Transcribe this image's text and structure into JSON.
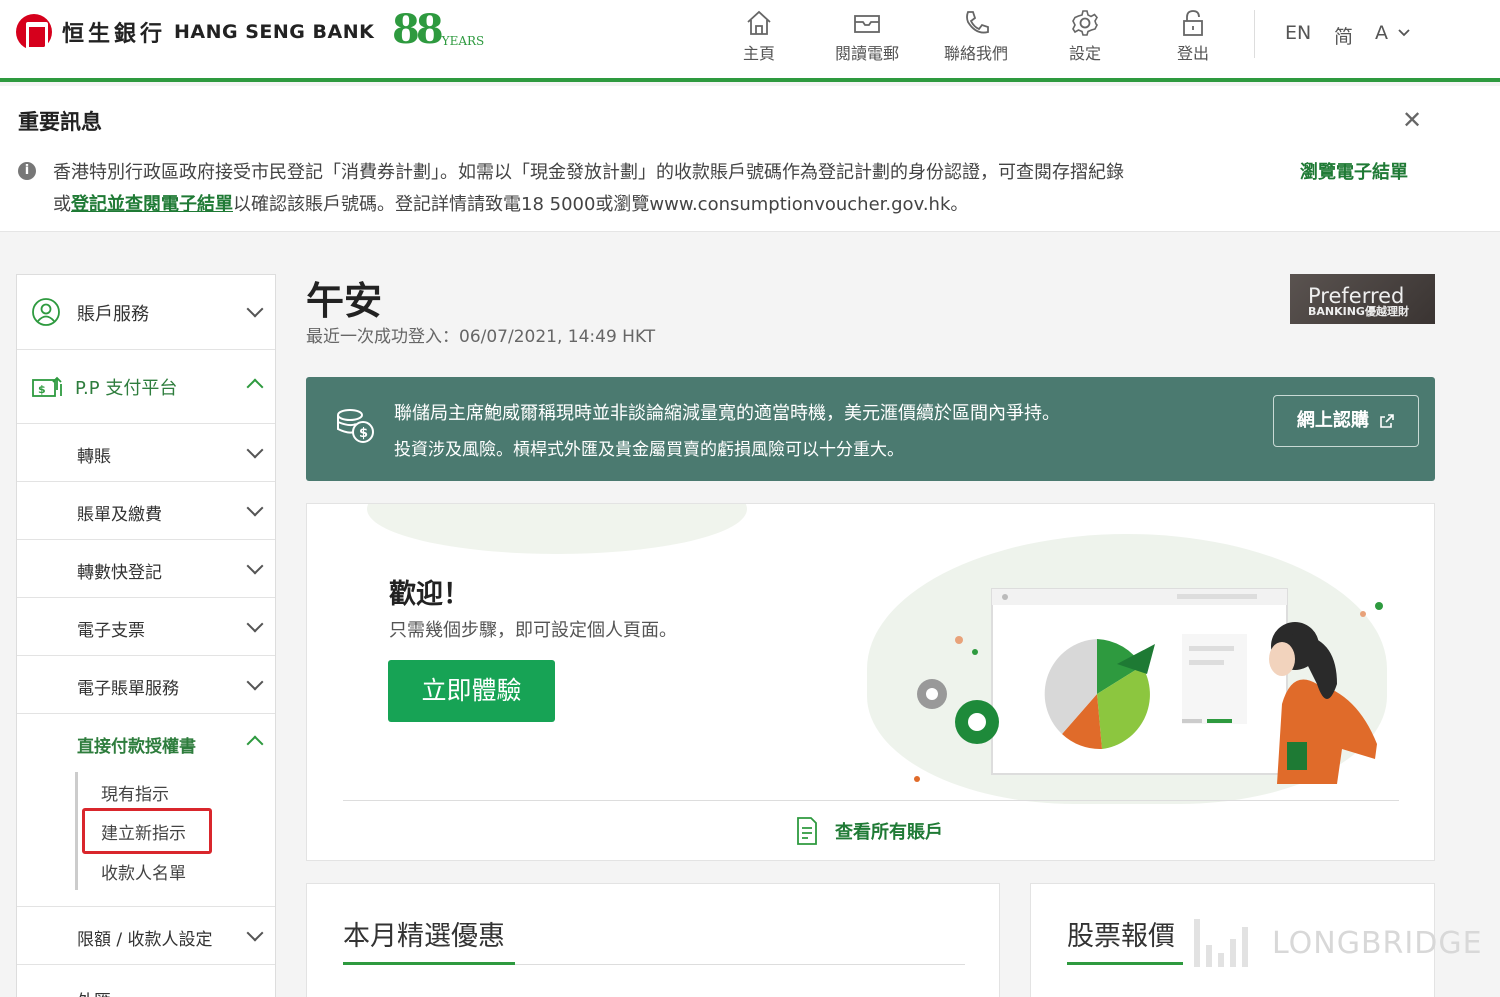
{
  "header": {
    "logo_cn": "恒生銀行",
    "logo_en": "HANG SENG BANK",
    "anniversary_number": "88",
    "anniversary_text": "YEARS",
    "nav": [
      {
        "label": "主頁",
        "icon": "home-icon"
      },
      {
        "label": "閱讀電郵",
        "icon": "mail-icon"
      },
      {
        "label": "聯絡我們",
        "icon": "phone-icon"
      },
      {
        "label": "設定",
        "icon": "gear-icon"
      },
      {
        "label": "登出",
        "icon": "lock-icon"
      }
    ],
    "lang_en": "EN",
    "lang_sc": "简",
    "font_size": "A"
  },
  "notice": {
    "title": "重要訊息",
    "line1": "香港特別行政區政府接受市民登記「消費券計劃」。如需以「現金發放計劃」的收款賬戶號碼作為登記計劃的身份認證，可查閱存摺紀錄",
    "line2_prefix": "或",
    "line2_link": "登記並查閱電子結單",
    "line2_suffix": "以確認該賬戶號碼。登記詳情請致電18 5000或瀏覽www.consumptionvoucher.gov.hk。",
    "browse_link": "瀏覽電子結單"
  },
  "sidebar": {
    "account_services": "賬戶服務",
    "payment_platform": "P.P 支付平台",
    "items": [
      {
        "label": "轉賬"
      },
      {
        "label": "賬單及繳費"
      },
      {
        "label": "轉數快登記"
      },
      {
        "label": "電子支票"
      },
      {
        "label": "電子賬單服務"
      }
    ],
    "direct_debit": "直接付款授權書",
    "sub_items": [
      {
        "label": "現有指示"
      },
      {
        "label": "建立新指示"
      },
      {
        "label": "收款人名單"
      }
    ],
    "limit_settings": "限額 / 收款人設定",
    "next_item": "外匯"
  },
  "main": {
    "greeting": "午安",
    "last_login": "最近一次成功登入：06/07/2021, 14:49 HKT",
    "preferred_1": "Preferred",
    "preferred_2": "BANKING優越理財",
    "banner_line1": "聯儲局主席鮑威爾稱現時並非談論縮減量寬的適當時機，美元滙價續於區間內爭持。",
    "banner_line2": "投資涉及風險。槓桿式外匯及貴金屬買賣的虧損風險可以十分重大。",
    "banner_button": "網上認購",
    "welcome_title": "歡迎！",
    "welcome_sub": "只需幾個步驟，即可設定個人頁面。",
    "try_button": "立即體驗",
    "all_accounts": "查看所有賬戶",
    "promo_title": "本月精選優惠",
    "stock_title": "股票報價"
  },
  "watermark": "LONGBRIDGE",
  "colors": {
    "brand_green": "#2e9a3f",
    "banner_teal": "#4b7a70",
    "cta_green": "#17a355",
    "highlight_red": "#d9262c"
  }
}
